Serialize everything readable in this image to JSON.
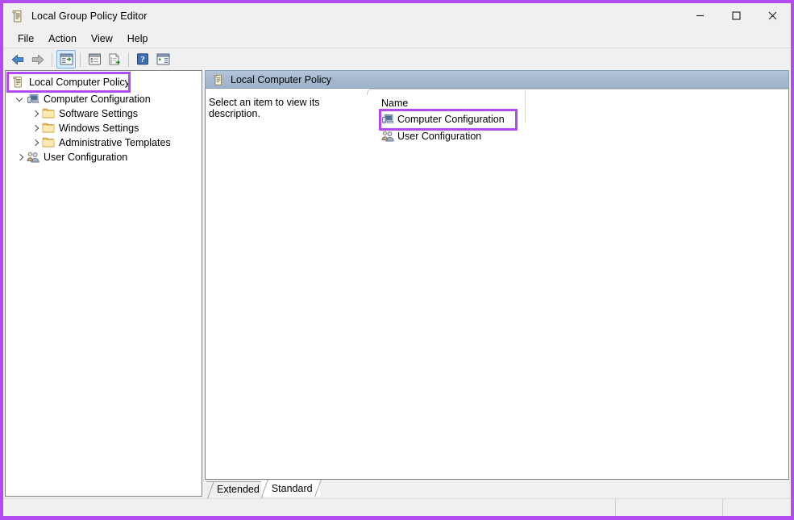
{
  "window": {
    "title": "Local Group Policy Editor",
    "title_icon": "policy-scroll-icon",
    "controls": {
      "minimize": "minimize-icon",
      "maximize": "maximize-icon",
      "close": "close-icon"
    }
  },
  "accent": {
    "highlight": "#b24cf0",
    "header_banner": "#a5b8ce",
    "toolbar_active": "#d8ecfb"
  },
  "menubar": {
    "items": [
      {
        "label": "File"
      },
      {
        "label": "Action"
      },
      {
        "label": "View"
      },
      {
        "label": "Help"
      }
    ]
  },
  "toolbar": {
    "buttons": [
      {
        "name": "back-icon",
        "title": "Back"
      },
      {
        "name": "forward-icon",
        "title": "Forward"
      },
      {
        "name": "separator-1",
        "title": ""
      },
      {
        "name": "show-hide-console-tree-icon",
        "title": "Show/Hide Console Tree",
        "active": true
      },
      {
        "name": "separator-2",
        "title": ""
      },
      {
        "name": "properties-icon",
        "title": "Properties"
      },
      {
        "name": "export-list-icon",
        "title": "Export List"
      },
      {
        "name": "separator-3",
        "title": ""
      },
      {
        "name": "help-icon",
        "title": "Help"
      },
      {
        "name": "show-hide-action-pane-icon",
        "title": "Show/Hide Action Pane"
      }
    ]
  },
  "tree": {
    "root": {
      "label": "Local Computer Policy",
      "icon": "policy-scroll-icon",
      "highlighted": true
    },
    "nodes": [
      {
        "label": "Computer Configuration",
        "icon": "computer-icon",
        "expanded": true,
        "indent": 1,
        "children": [
          {
            "label": "Software Settings",
            "icon": "folder-icon",
            "expanded": false,
            "indent": 2
          },
          {
            "label": "Windows Settings",
            "icon": "folder-icon",
            "expanded": false,
            "indent": 2
          },
          {
            "label": "Administrative Templates",
            "icon": "folder-icon",
            "expanded": false,
            "indent": 2
          }
        ]
      },
      {
        "label": "User Configuration",
        "icon": "user-icon",
        "expanded": false,
        "indent": 1,
        "children": []
      }
    ]
  },
  "right_pane": {
    "header": {
      "title": "Local Computer Policy",
      "icon": "policy-scroll-icon"
    },
    "description": "Select an item to view its description.",
    "list": {
      "column_header": "Name",
      "items": [
        {
          "label": "Computer Configuration",
          "icon": "computer-icon",
          "highlighted": true
        },
        {
          "label": "User Configuration",
          "icon": "user-icon",
          "highlighted": false
        }
      ]
    },
    "tabs": [
      {
        "label": "Extended",
        "selected": false
      },
      {
        "label": "Standard",
        "selected": true
      }
    ]
  },
  "statusbar": {
    "main": "",
    "pane_a": "",
    "pane_b": ""
  }
}
